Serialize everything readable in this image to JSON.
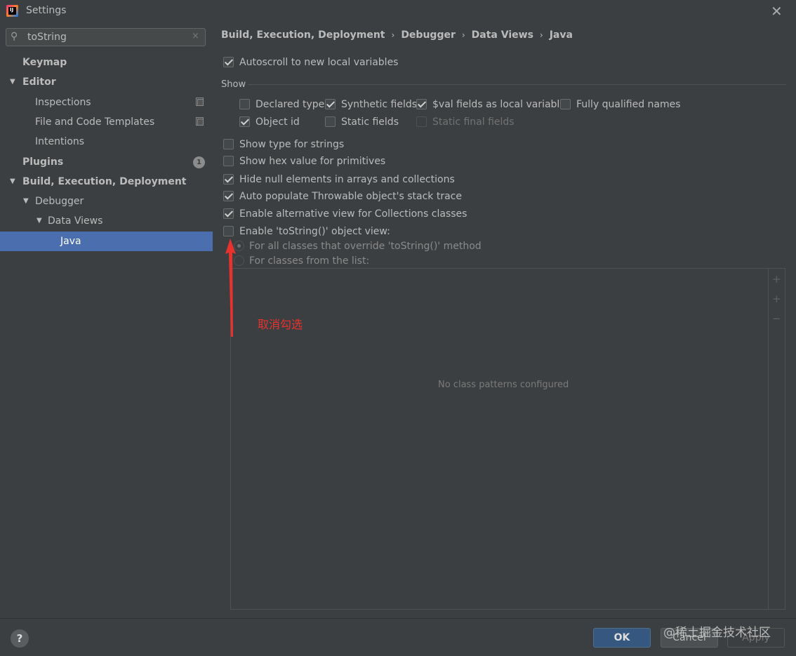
{
  "window": {
    "title": "Settings",
    "close_glyph": "✕"
  },
  "search": {
    "value": "toString",
    "clear_glyph": "×",
    "icon": "search-icon"
  },
  "tree": [
    {
      "label": "Keymap",
      "bold": true
    },
    {
      "label": "Editor",
      "bold": true,
      "expanded": true
    },
    {
      "label": "Inspections"
    },
    {
      "label": "File and Code Templates"
    },
    {
      "label": "Intentions"
    },
    {
      "label": "Plugins",
      "bold": true,
      "badge": "1"
    },
    {
      "label": "Build, Execution, Deployment",
      "bold": true,
      "expanded": true
    },
    {
      "label": "Debugger",
      "expanded": true
    },
    {
      "label": "Data Views",
      "expanded": true
    },
    {
      "label": "Java",
      "selected": true
    }
  ],
  "breadcrumb": [
    "Build, Execution, Deployment",
    "Debugger",
    "Data Views",
    "Java"
  ],
  "breadcrumb_sep": "›",
  "options": {
    "autoscroll": {
      "label": "Autoscroll to new local variables",
      "checked": true
    },
    "show_section": "Show",
    "show_items": {
      "declared_type": {
        "label": "Declared type",
        "checked": false
      },
      "synthetic_fields": {
        "label": "Synthetic fields",
        "checked": true
      },
      "val_fields": {
        "label": "$val fields as local variables",
        "checked": true
      },
      "fully_qualified": {
        "label": "Fully qualified names",
        "checked": false
      },
      "object_id": {
        "label": "Object id",
        "checked": true
      },
      "static_fields": {
        "label": "Static fields",
        "checked": false
      },
      "static_final_fields": {
        "label": "Static final fields",
        "checked": false,
        "disabled": true
      }
    },
    "show_type_strings": {
      "label": "Show type for strings",
      "checked": false
    },
    "show_hex": {
      "label": "Show hex value for primitives",
      "checked": false
    },
    "hide_null": {
      "label": "Hide null elements in arrays and collections",
      "checked": true
    },
    "auto_populate": {
      "label": "Auto populate Throwable object's stack trace",
      "checked": true
    },
    "alt_view": {
      "label": "Enable alternative view for Collections classes",
      "checked": true
    },
    "tostring_view": {
      "label": "Enable 'toString()' object view:",
      "checked": false
    },
    "radio_all": {
      "label": "For all classes that override 'toString()' method",
      "selected": true
    },
    "radio_list": {
      "label": "For classes from the list:",
      "selected": false
    }
  },
  "list": {
    "empty_text": "No class patterns configured",
    "toolbar": [
      "+",
      "+",
      "−"
    ]
  },
  "annotation": {
    "text": "取消勾选",
    "color": "#e8322e"
  },
  "footer": {
    "help": "?",
    "ok": "OK",
    "cancel": "Cancel",
    "apply": "Apply",
    "watermark": "@稀土掘金技术社区"
  },
  "colors": {
    "selection": "#4b6eaf",
    "background": "#3c3f41",
    "ok_button": "#365880"
  }
}
